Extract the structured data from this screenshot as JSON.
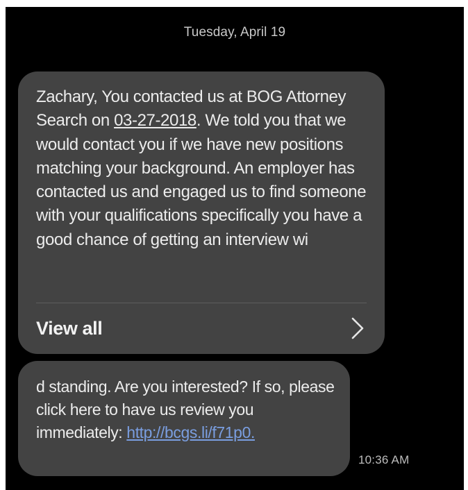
{
  "header": {
    "date": "Tuesday, April 19"
  },
  "messages": [
    {
      "text_before_date": "Zachary, You contacted us at BOG Attorney Search on ",
      "date_link": "03-27-2018",
      "text_after_date": ". We told you that we would contact you if we have new positions matching your background. An employer has contacted us and engaged us to find someone with your qualifications specifically you have a good chance of getting an interview wi",
      "view_all_label": "View all",
      "view_all_icon": "chevron-right-icon"
    },
    {
      "text": "d standing. Are you interested? If so, please click here to have us review you immediately: ",
      "link": "http://bcgs.li/f71p0.",
      "time": "10:36 AM"
    }
  ],
  "colors": {
    "background": "#000000",
    "bubble": "#434343",
    "text": "#ececec",
    "link": "#7a9ee0"
  }
}
